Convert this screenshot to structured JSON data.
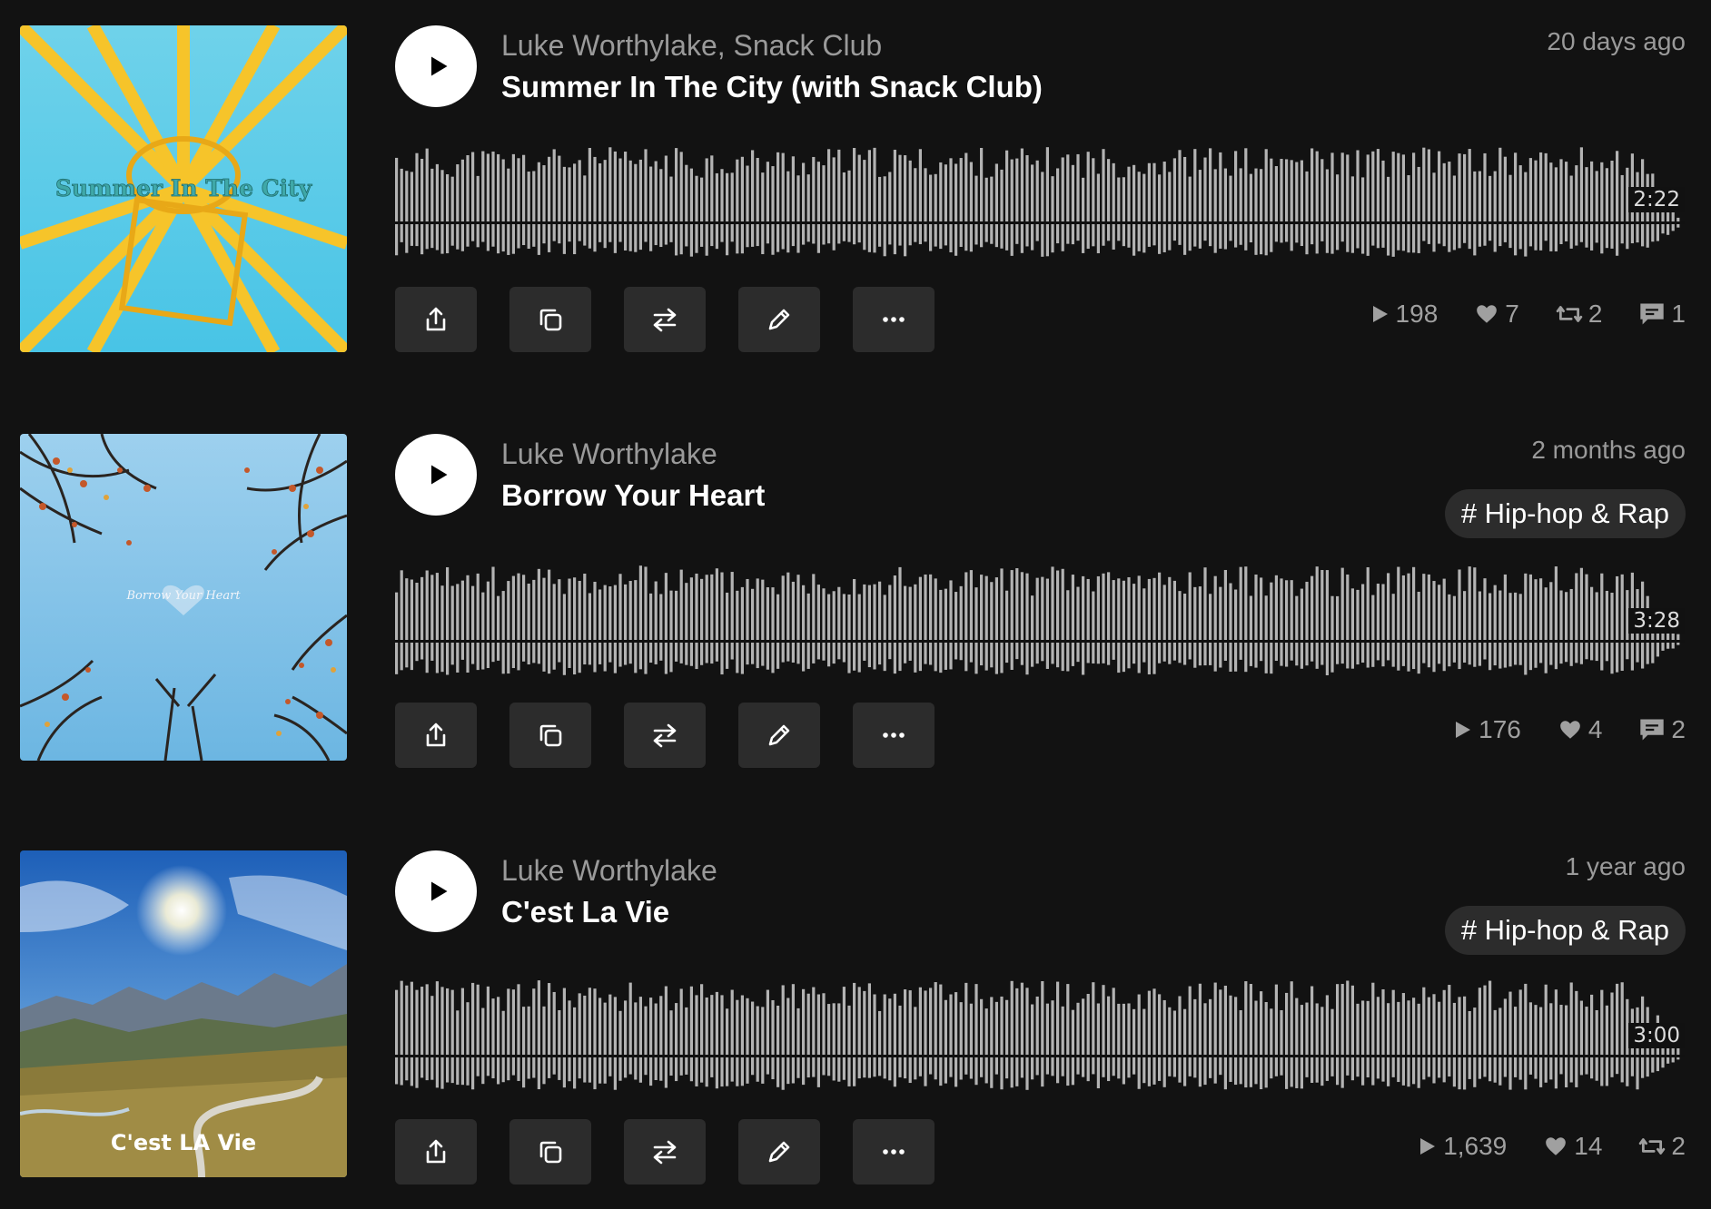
{
  "colors": {
    "background": "#121212",
    "button_bg": "#2c2c2c",
    "wave_bar": "#b3b3b3",
    "muted_text": "#9a9a9a"
  },
  "icons": {
    "play": "play-icon",
    "share": "share-icon",
    "copy": "copy-icon",
    "repost_action": "swap-icon",
    "edit": "pencil-icon",
    "more": "more-dots-icon",
    "plays": "play-count-icon",
    "likes": "heart-icon",
    "reposts": "repost-icon",
    "comments": "comment-icon"
  },
  "tracks": [
    {
      "artist": "Luke Worthylake, Snack Club",
      "title": "Summer In The City (with Snack Club)",
      "date": "20 days ago",
      "tag": "",
      "duration": "2:22",
      "cover_text": "Summer In The City",
      "stats": {
        "plays": "198",
        "likes": "7",
        "reposts": "2",
        "comments": "1"
      }
    },
    {
      "artist": "Luke Worthylake",
      "title": "Borrow Your Heart",
      "date": "2 months ago",
      "tag": "# Hip-hop & Rap",
      "duration": "3:28",
      "cover_text": "Borrow Your Heart",
      "stats": {
        "plays": "176",
        "likes": "4",
        "comments": "2"
      }
    },
    {
      "artist": "Luke Worthylake",
      "title": "C'est La Vie",
      "date": "1 year ago",
      "tag": "# Hip-hop & Rap",
      "duration": "3:00",
      "cover_text": "C'est LA Vie",
      "stats": {
        "plays": "1,639",
        "likes": "14",
        "reposts": "2"
      }
    }
  ]
}
